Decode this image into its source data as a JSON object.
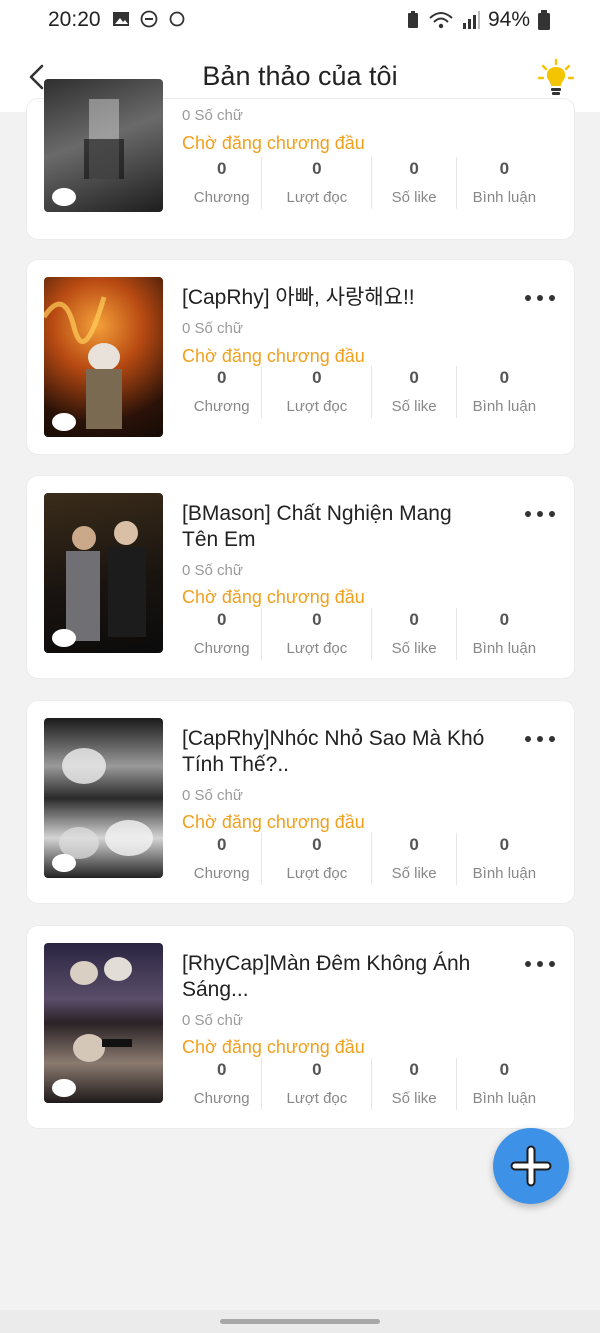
{
  "status_bar": {
    "time": "20:20",
    "battery": "94%"
  },
  "header": {
    "title": "Bản thảo của tôi"
  },
  "stat_labels": {
    "chapters": "Chương",
    "reads": "Lượt đọc",
    "likes": "Số like",
    "comments": "Bình luận"
  },
  "drafts": [
    {
      "title": "",
      "word_count": "0 Số chữ",
      "status": "Chờ đăng chương đầu",
      "chapters": "0",
      "reads": "0",
      "likes": "0",
      "comments": "0"
    },
    {
      "title": "[CapRhy] 아빠, 사랑해요!!",
      "word_count": "0 Số chữ",
      "status": "Chờ đăng chương đầu",
      "chapters": "0",
      "reads": "0",
      "likes": "0",
      "comments": "0"
    },
    {
      "title": "[BMason] Chất Nghiện Mang Tên Em",
      "word_count": "0 Số chữ",
      "status": "Chờ đăng chương đầu",
      "chapters": "0",
      "reads": "0",
      "likes": "0",
      "comments": "0"
    },
    {
      "title": "[CapRhy]Nhóc Nhỏ Sao Mà Khó Tính Thế?..",
      "word_count": "0 Số chữ",
      "status": "Chờ đăng chương đầu",
      "chapters": "0",
      "reads": "0",
      "likes": "0",
      "comments": "0"
    },
    {
      "title": "[RhyCap]Màn Đêm Không Ánh Sáng...",
      "word_count": "0 Số chữ",
      "status": "Chờ đăng chương đầu",
      "chapters": "0",
      "reads": "0",
      "likes": "0",
      "comments": "0"
    }
  ],
  "colors": {
    "status": "#f0a01c",
    "fab": "#3d92e8",
    "bulb": "#f5c400"
  },
  "icons": {
    "back": "chevron-left-icon",
    "idea": "lightbulb-icon",
    "more": "more-horizontal-icon",
    "add": "plus-icon"
  }
}
